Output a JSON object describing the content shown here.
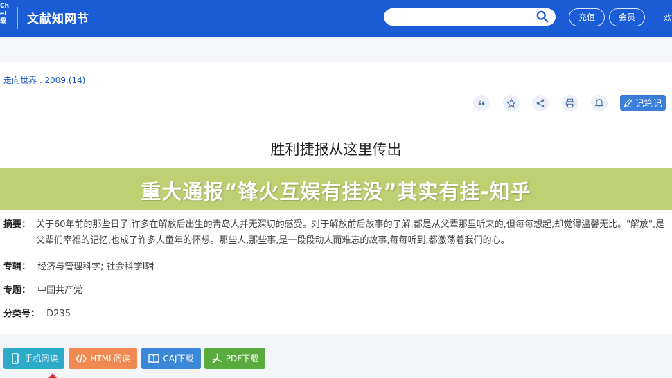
{
  "header": {
    "logo_fragment": [
      "Ch",
      "et",
      "载"
    ],
    "site_title": "文献知网节",
    "search": {
      "value": "",
      "placeholder": ""
    },
    "recharge_label": "充值",
    "member_label": "会员",
    "more_fragment": "欢"
  },
  "article": {
    "source": "走向世界 . 2009,(14)",
    "title": "胜利捷报从这里传出",
    "note_label": "记笔记",
    "tools": [
      "quote-icon",
      "star-icon",
      "share-icon",
      "print-icon",
      "bell-icon"
    ]
  },
  "banner": {
    "text": "重大通报“锋火互娱有挂没”其实有挂-知乎"
  },
  "meta": {
    "abstract_label": "摘要：",
    "abstract_text": "关于60年前的那些日子,许多在解放后出生的青岛人并无深切的感受。对于解放前后故事的了解,都是从父辈那里听来的,但每每想起,却觉得温馨无比。\"解放\",是父辈们幸福的记忆,也成了许多人童年的怀想。那些人,那些事,是一段段动人而难忘的故事,每每听到,都激荡着我们的心。",
    "series_label": "专辑：",
    "series_value": "经济与管理科学; 社会科学Ⅰ辑",
    "topic_label": "专题：",
    "topic_value": "中国共产党",
    "class_label": "分类号：",
    "class_value": "D235"
  },
  "downloads": {
    "mobile": "手机阅读",
    "html": "HTML阅读",
    "caj": "CAJ下载",
    "pdf": "PDF下载"
  },
  "colors": {
    "header_bg": "#1a5bd6",
    "banner_bg": "#baCC68",
    "mobile_btn": "#2eaac9",
    "html_btn": "#f08a52",
    "caj_btn": "#3b87d8",
    "pdf_btn": "#5aab3e",
    "note_btn": "#3b7ed8"
  }
}
